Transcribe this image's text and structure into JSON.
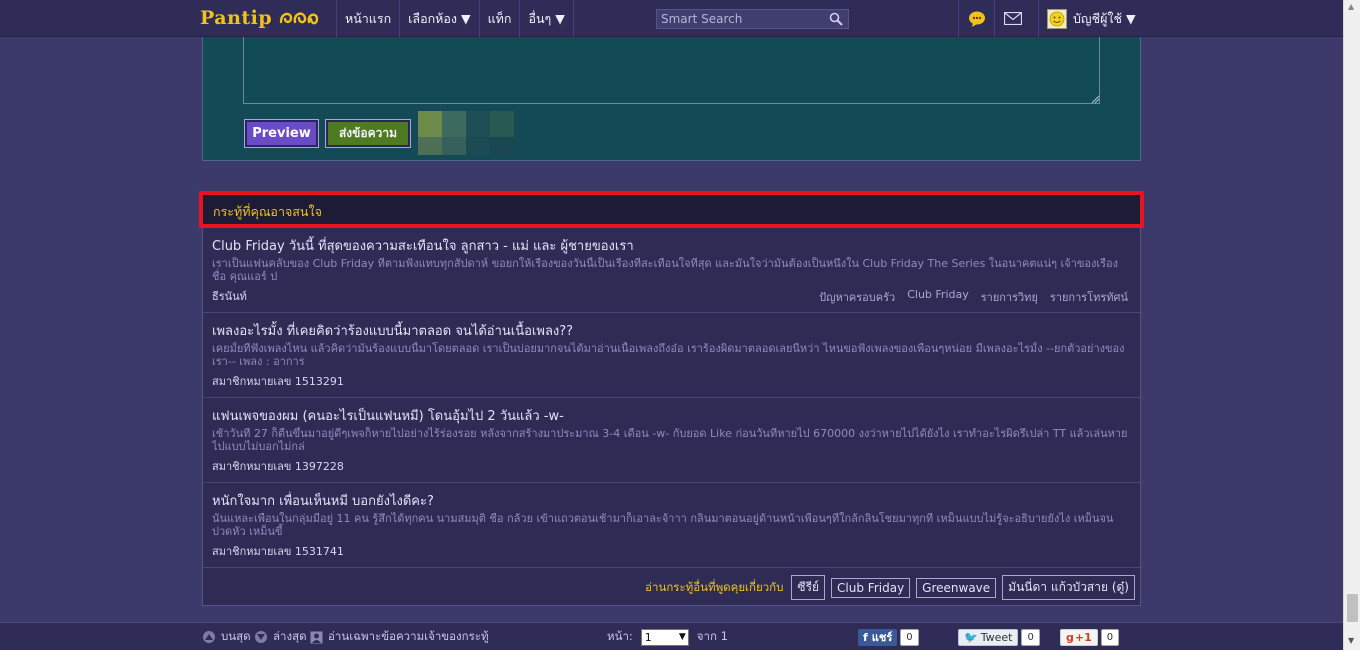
{
  "header": {
    "logo": "Pantip",
    "nav": [
      "หน้าแรก",
      "เลือกห้อง ▼",
      "แท็ก",
      "อื่นๆ ▼"
    ],
    "search_placeholder": "Smart Search",
    "account_label": "บัญชีผู้ใช้ ▼"
  },
  "comment": {
    "preview_label": "Preview",
    "submit_label": "ส่งข้อความ"
  },
  "recommended": {
    "heading": "กระทู้ที่คุณอาจสนใจ",
    "topics": [
      {
        "title": "Club Friday วันนี้ ที่สุดของความสะเทือนใจ ลูกสาว - แม่ และ ผู้ชายของเรา",
        "desc": "เราเป็นแฟนคลับของ Club Friday ที่ตามฟังแทบทุกสัปดาห์ ขอยกให้เรื่องของวันนี้เป็นเรื่องที่สะเทือนใจที่สุด และมั่นใจว่ามันต้องเป็นหนึ่งใน Club Friday The Series ในอนาคตแน่ๆ เจ้าของเรื่องชื่อ คุณแอร์ ป",
        "author": "ธีรนันท์",
        "tags": [
          "ปัญหาครอบครัว",
          "Club Friday",
          "รายการวิทยุ",
          "รายการโทรทัศน์"
        ]
      },
      {
        "title": "เพลงอะไรมั้ง ที่เคยคิดว่าร้องแบบนี้มาตลอด จนได้อ่านเนื้อเพลง??",
        "desc": "เคยมั้ยที่ฟังเพลงไหน แล้วคิดว่ามันร้องแบบนี้มาโดยตลอด เราเป็นบ่อยมากจนได้มาอ่านเนื้อเพลงถึงอ๋อ เราร้องผิดมาตลอดเลยนี่หว่า ไหนขอฟังเพลงของเพื่อนๆหน่อย มีเพลงอะไรมั้ง --ยกตัวอย่างของเรา-- เพลง : อาการ",
        "author": "สมาชิกหมายเลข 1513291",
        "tags": []
      },
      {
        "title": "แฟนเพจของผม (คนอะไรเป็นแฟนหมี) โดนอุ้มไป 2 วันแล้ว -w-",
        "desc": "เช้าวันที่ 27 ก็ตื่นขึ้นมาอยู่ดีๆเพจก็หายไปอย่างไร้ร่องรอย หลังจากสร้างมาประมาณ 3-4 เดือน -w- กับยอด Like ก่อนวันที่หายไป 670000 งงว่าหายไปได้ยังไง เราทำอะไรผิดรึเปล่า TT แล้วเล่นหายไปแบบไม่บอกไม่กล่",
        "author": "สมาชิกหมายเลข 1397228",
        "tags": []
      },
      {
        "title": "หนักใจมาก เพื่อนเห็นหมี บอกยังไงดีคะ?",
        "desc": "นั่นแหละเพื่อนในกลุ่มมีอยู่ 11 คน รู้สึกได้ทุกคน นามสมมุติ ชื่อ กล้วย เข้าแถวตอนเช้ามาก็เอาละจ้าาา กลิ่นมาตอนอยู่ด้านหน้าเพื่อนๆที่ใกล้กลิ่นโชยมาทุกที เหม็นแบบไม่รู้จะอธิบายยังไง เหม็นจนปวดหัว เหม็นขี้",
        "author": "สมาชิกหมายเลข 1531741",
        "tags": []
      }
    ],
    "footer_text": "อ่านกระทู้อื่นที่พูดคุยเกี่ยวกับ",
    "footer_tags": [
      "ซีรีย์",
      "Club Friday",
      "Greenwave",
      "มันนี่ดา แก้วบัวสาย (ดู๋)"
    ]
  },
  "bottombar": {
    "top_label": "บนสุด",
    "bottom_label": "ล่างสุด",
    "owner_only_label": "อ่านเฉพาะข้อความเจ้าของกระทู้",
    "page_label": "หน้า:",
    "page_value": "1",
    "of_label": "จาก 1",
    "fb_label": "แชร์",
    "fb_count": "0",
    "tweet_label": "Tweet",
    "tweet_count": "0",
    "gplus_label": "+1",
    "gplus_count": "0"
  },
  "colors": {
    "background": "#3c3a6a",
    "header": "#2f2d58",
    "accent_yellow": "#f2c21a",
    "highlight_red": "#e8141e",
    "comment_bg": "#134a55"
  }
}
